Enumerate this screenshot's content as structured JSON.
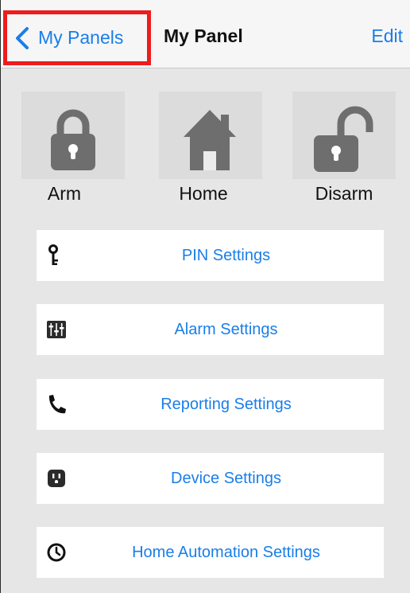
{
  "nav": {
    "back_label": "My Panels",
    "title": "My Panel",
    "edit_label": "Edit"
  },
  "modes": [
    {
      "label": "Arm",
      "icon": "lock-closed-icon"
    },
    {
      "label": "Home",
      "icon": "house-icon"
    },
    {
      "label": "Disarm",
      "icon": "lock-open-icon"
    }
  ],
  "settings": [
    {
      "label": "PIN Settings",
      "icon": "key-icon"
    },
    {
      "label": "Alarm Settings",
      "icon": "sliders-icon"
    },
    {
      "label": "Reporting Settings",
      "icon": "phone-icon"
    },
    {
      "label": "Device Settings",
      "icon": "outlet-icon"
    },
    {
      "label": "Home Automation Settings",
      "icon": "clock-icon"
    }
  ],
  "colors": {
    "accent": "#1a7ee8",
    "highlight_box": "#ee1c1c",
    "icon_gray": "#6e6e6e",
    "background": "#e6e6e6"
  }
}
